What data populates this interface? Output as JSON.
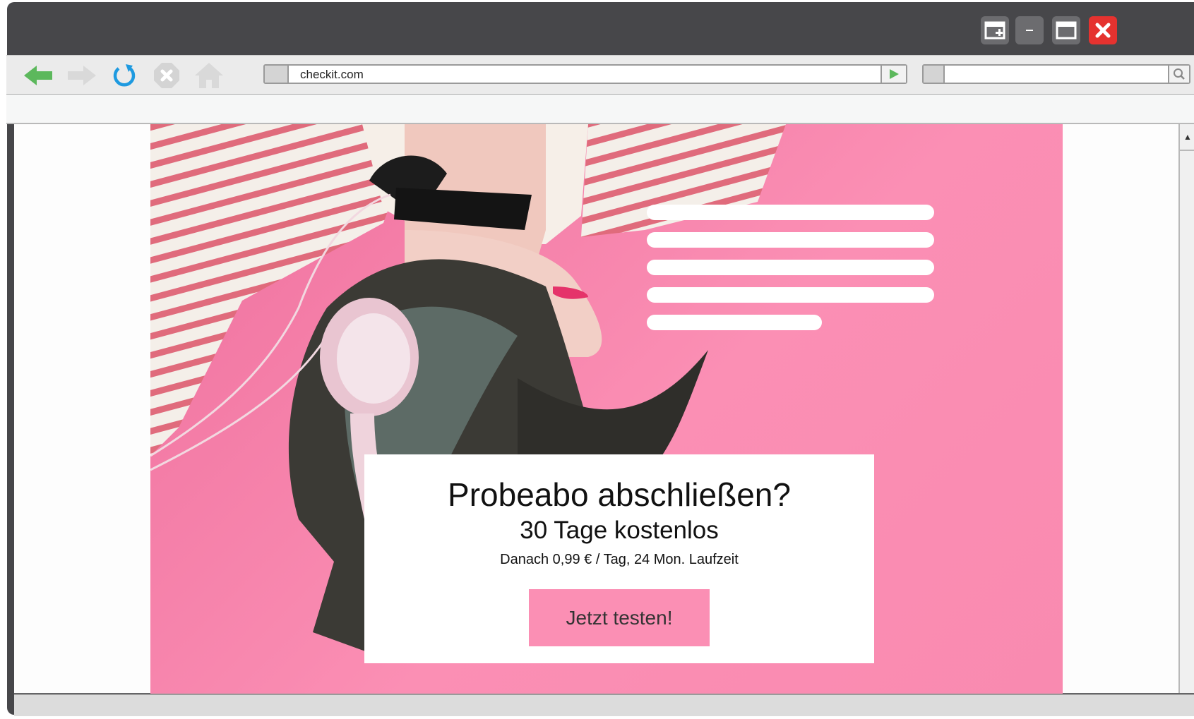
{
  "browser": {
    "url": "checkit.com",
    "search_placeholder": "",
    "nav_icons": [
      "back-arrow-icon",
      "forward-arrow-icon",
      "refresh-icon",
      "stop-icon",
      "home-icon"
    ],
    "window_controls": [
      "restore-window-icon",
      "minimize-icon",
      "maximize-icon",
      "close-icon"
    ]
  },
  "colors": {
    "accent_pink": "#fb8fb4",
    "hero_pink": "#ee6f9d",
    "back_green": "#5cb85c",
    "refresh_blue": "#1e9ae0",
    "close_red": "#e5322f"
  },
  "offer": {
    "title": "Probeabo abschließen?",
    "subtitle": "30 Tage kostenlos",
    "note": "Danach 0,99 € / Tag, 24 Mon. Laufzeit",
    "cta_label": "Jetzt testen!"
  }
}
